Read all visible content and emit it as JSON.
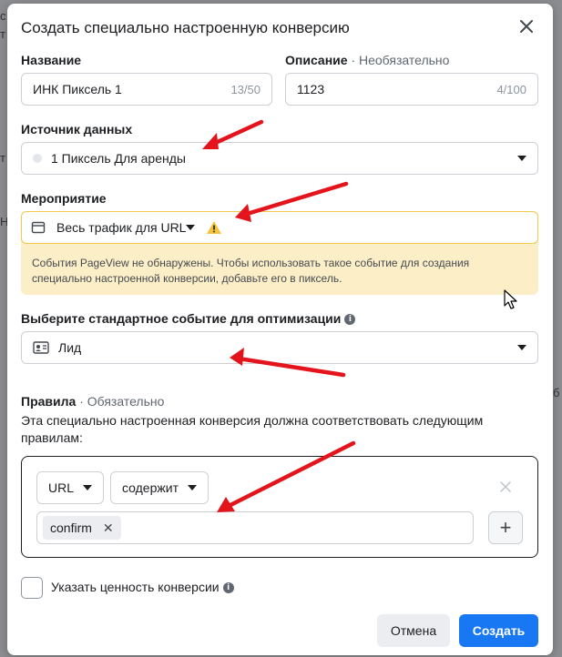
{
  "background": {
    "left_fragments": [
      "с",
      "",
      "т",
      "",
      "Н"
    ],
    "right_fragment": "б"
  },
  "dialog": {
    "title": "Создать специально настроенную конверсию",
    "name": {
      "label": "Название",
      "value": "ИНК Пиксель 1",
      "counter": "13/50"
    },
    "description": {
      "label": "Описание",
      "optional": "· Необязательно",
      "value": "1123",
      "counter": "4/100"
    },
    "data_source": {
      "label": "Источник данных",
      "value": "1 Пиксель Для аренды"
    },
    "event": {
      "label": "Мероприятие",
      "value": "Весь трафик для URL",
      "warning": "События PageView не обнаружены. Чтобы использовать такое событие для создания специально настроенной конверсии, добавьте его в пиксель."
    },
    "standard_event": {
      "label": "Выберите стандартное событие для оптимизации",
      "value": "Лид"
    },
    "rules": {
      "label": "Правила",
      "required": "· Обязательно",
      "description": "Эта специально настроенная конверсия должна соответствовать следующим правилам:",
      "field_select": "URL",
      "operator_select": "содержит",
      "tag": "confirm"
    },
    "conversion_value": {
      "label": "Указать ценность конверсии"
    },
    "buttons": {
      "cancel": "Отмена",
      "create": "Создать"
    }
  },
  "colors": {
    "primary": "#1877f2",
    "warning_bg": "#fcefc7",
    "warning_icon": "#f5c33b",
    "annotation_arrow": "#e3141b"
  }
}
